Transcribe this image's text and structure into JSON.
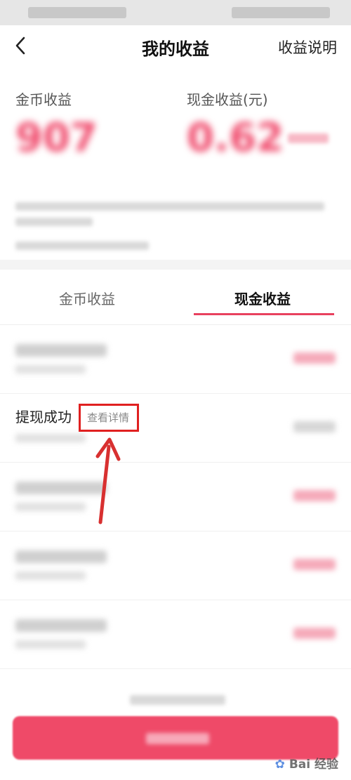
{
  "header": {
    "title": "我的收益",
    "right_link": "收益说明"
  },
  "summary": {
    "coin_label": "金币收益",
    "cash_label": "现金收益(元)",
    "coin_value": "907",
    "cash_value": "0.62"
  },
  "tabs": [
    {
      "label": "金币收益",
      "active": false
    },
    {
      "label": "现金收益",
      "active": true
    }
  ],
  "list": {
    "highlighted_item": {
      "title": "提现成功",
      "detail_link": "查看详情"
    }
  },
  "watermark": {
    "text": "Bai 经验"
  },
  "colors": {
    "accent": "#e8415e",
    "highlight_box": "#e02020"
  }
}
